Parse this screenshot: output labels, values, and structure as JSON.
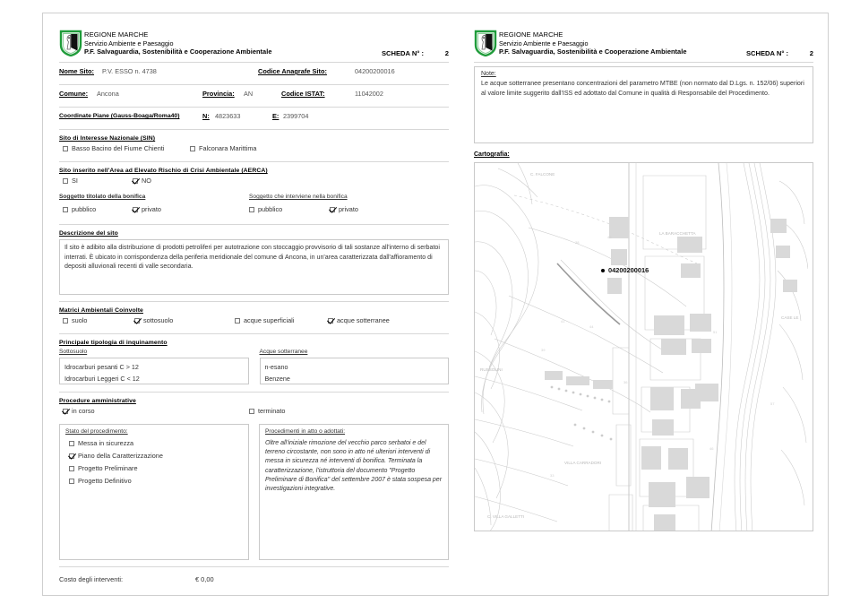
{
  "header": {
    "org_line1": "REGIONE MARCHE",
    "org_line2": "Servizio Ambiente e Paesaggio",
    "org_line3": "P.F. Salvaguardia, Sostenibilità e  Cooperazione Ambientale",
    "scheda_label": "SCHEDA N° :",
    "scheda_number": "2",
    "logo_icon": "regione-marche-shield-logo"
  },
  "fields": {
    "nome_sito_label": "Nome Sito:",
    "nome_sito_value": "P.V. ESSO n. 4738",
    "codice_anagrafe_label": "Codice Anagrafe Sito:",
    "codice_anagrafe_value": "04200200016",
    "comune_label": "Comune:",
    "comune_value": "Ancona",
    "provincia_label": "Provincia:",
    "provincia_value": "AN",
    "codice_istat_label": "Codice ISTAT:",
    "codice_istat_value": "11042002",
    "coordinate_label": "Coordinate Piane (Gauss-Boaga/Roma40)",
    "nord_label": "N:",
    "nord_value": "4823633",
    "est_label": "E:",
    "est_value": "2399704"
  },
  "sin": {
    "title": "Sito di Interesse Nazionale (SIN)",
    "options": [
      {
        "label": "Basso Bacino del Fiume Chienti",
        "checked": false
      },
      {
        "label": "Falconara Marittima",
        "checked": false
      }
    ]
  },
  "aerca": {
    "title": "Sito inserito nell'Area ad Elevato Rischio di Crisi Ambientale (AERCA)",
    "options": [
      {
        "label": "SI",
        "checked": false
      },
      {
        "label": "NO",
        "checked": true
      }
    ]
  },
  "soggetti": {
    "titolato_title": "Soggetto titolato della bonifica",
    "interviene_title": "Soggetto che interviene nella bonifica",
    "titolato_options": [
      {
        "label": "pubblico",
        "checked": false
      },
      {
        "label": "privato",
        "checked": true
      }
    ],
    "interviene_options": [
      {
        "label": "pubblico",
        "checked": false
      },
      {
        "label": "privato",
        "checked": true
      }
    ]
  },
  "descrizione": {
    "title": "Descrizione del sito",
    "text": "Il sito è adibito alla distribuzione di prodotti petroliferi per autotrazione con stoccaggio provvisorio di tali sostanze all'interno di serbatoi interrati.  È ubicato in corrispondenza della periferia meridionale del comune di Ancona, in un'area caratterizzata dall'affioramento di depositi alluvionali recenti di valle secondaria."
  },
  "matrici": {
    "title": "Matrici Ambientali Coinvolte",
    "options": [
      {
        "label": "suolo",
        "checked": false
      },
      {
        "label": "sottosuolo",
        "checked": true
      },
      {
        "label": "acque superficiali",
        "checked": false
      },
      {
        "label": "acque sotterranee",
        "checked": true
      }
    ]
  },
  "inquinamento": {
    "title": "Principale tipologia di inquinamento",
    "sottosuolo_label": "Sottosuolo",
    "acque_label": "Acque sotterranee",
    "sottosuolo_items": [
      "Idrocarburi pesanti C > 12",
      "Idrocarburi Leggeri C < 12"
    ],
    "acque_items": [
      "n-esano",
      "Benzene"
    ]
  },
  "procedure": {
    "title": "Procedure amministrative",
    "in_corso": {
      "label": "in corso",
      "checked": true
    },
    "terminato": {
      "label": "terminato",
      "checked": false
    },
    "stato_title": "Stato del procedimento:",
    "stato_options": [
      {
        "label": "Messa  in  sicurezza",
        "checked": false
      },
      {
        "label": "Piano  della  Caratterizzazione",
        "checked": true
      },
      {
        "label": "Progetto  Preliminare",
        "checked": false
      },
      {
        "label": "Progetto  Definitivo",
        "checked": false
      }
    ],
    "procedimenti_title": "Procedimenti in atto o adottati:",
    "procedimenti_text": "Oltre all'iniziale rimozione del vecchio parco serbatoi e del terreno circostante, non sono in atto né ulteriori interventi di messa in sicurezza né interventi di bonifica. Terminata la caratterizzazione, l'istruttoria del documento \"Progetto Preliminare  di Bonifica\" del settembre 2007 è stata sospesa per investigazioni integrative."
  },
  "costo": {
    "label": "Costo degli interventi:",
    "value": "€ 0,00"
  },
  "note": {
    "title": "Note:",
    "text": "Le acque sotterranee presentano concentrazioni del parametro MTBE (non normato dal D.Lgs. n. 152/06) superiori al valore limite suggerito dall'ISS ed adottato dal Comune in qualità di Responsabile del Procedimento."
  },
  "cartografia": {
    "title": "Cartografia:",
    "map_code": "04200200016",
    "map_labels": [
      "C. FALCONE",
      "LA BARACCHETTA",
      "VILLA CARRADORI",
      "RUSSOLINI",
      "CASE LE",
      "C. VILLA GALLETTI"
    ]
  },
  "colors": {
    "logo_green": "#1f9c3a",
    "rule_gray": "#d7d7d7",
    "box_gray": "#c9c9c9",
    "text_gray": "#333333"
  }
}
